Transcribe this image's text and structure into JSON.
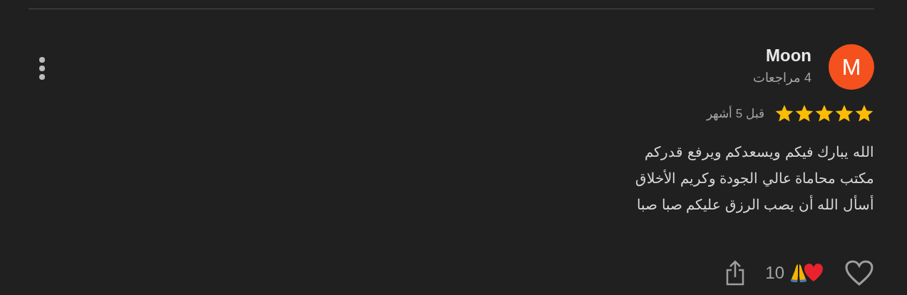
{
  "review": {
    "avatar_letter": "M",
    "author": "Moon",
    "review_count": "4 مراجعات",
    "stars": 5,
    "time": "قبل 5 أشهر",
    "lines": [
      "الله يبارك فيكم ويسعدكم ويرفع قدركم",
      "مكتب محاماة عالي الجودة وكريم الأخلاق",
      "أسأل الله أن يصب الرزق عليكم صبا صبا"
    ],
    "reaction_count": "10",
    "liked": false
  }
}
